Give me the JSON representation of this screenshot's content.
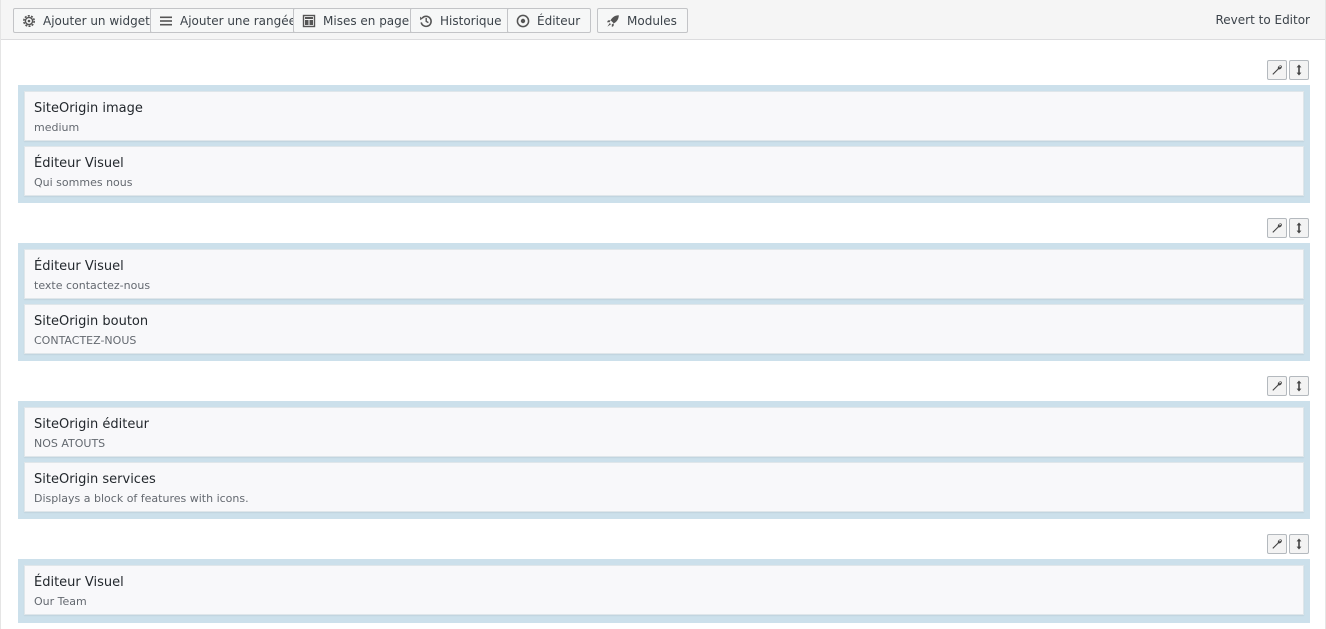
{
  "toolbar": {
    "add_widget": "Ajouter un widget",
    "add_row": "Ajouter une rangée",
    "layouts": "Mises en page",
    "history": "Historique",
    "editor": "Éditeur",
    "modules": "Modules",
    "revert": "Revert to Editor"
  },
  "icons": {
    "add_widget": "gear-icon",
    "add_row": "menu-lines-icon",
    "layouts": "layout-icon",
    "history": "history-icon",
    "editor": "eye-icon",
    "modules": "rocket-icon",
    "row_settings": "wrench-icon",
    "row_move": "move-arrows-icon"
  },
  "colors": {
    "row_background": "#cce0eb",
    "widget_background": "#f8f8fa",
    "toolbar_background": "#f5f5f5",
    "accent": "#0073aa"
  },
  "rows": [
    {
      "widgets": [
        {
          "title": "SiteOrigin image",
          "description": "medium"
        },
        {
          "title": "Éditeur Visuel",
          "description": "Qui sommes nous"
        }
      ]
    },
    {
      "widgets": [
        {
          "title": "Éditeur Visuel",
          "description": "texte contactez-nous"
        },
        {
          "title": "SiteOrigin bouton",
          "description": "CONTACTEZ-NOUS"
        }
      ]
    },
    {
      "widgets": [
        {
          "title": "SiteOrigin éditeur",
          "description": "NOS ATOUTS"
        },
        {
          "title": "SiteOrigin services",
          "description": "Displays a block of features with icons."
        }
      ]
    },
    {
      "widgets": [
        {
          "title": "Éditeur Visuel",
          "description": "Our Team"
        }
      ]
    }
  ]
}
